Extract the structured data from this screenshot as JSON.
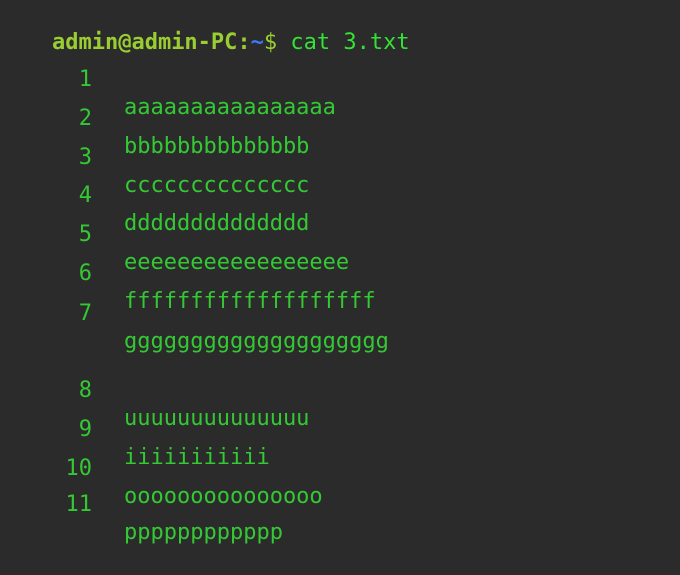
{
  "prompt": {
    "user_host": "admin@admin-PC",
    "colon": ":",
    "path": "~",
    "dollar": "$",
    "command": " cat 3.txt"
  },
  "lines": [
    {
      "num": "1",
      "text": "aaaaaaaaaaaaaaaa"
    },
    {
      "num": "2",
      "text": "bbbbbbbbbbbbbb"
    },
    {
      "num": "3",
      "text": "cccccccccccccc"
    },
    {
      "num": "4",
      "text": "dddddddddddddd"
    },
    {
      "num": "5",
      "text": "eeeeeeeeeeeeeeeee"
    },
    {
      "num": "6",
      "text": "fffffffffffffffffff"
    },
    {
      "num": "7",
      "text": "gggggggggggggggggggg"
    },
    {
      "num": "",
      "text": ""
    },
    {
      "num": "8",
      "text": "uuuuuuuuuuuuuu"
    },
    {
      "num": "9",
      "text": "iiiiiiiiiii"
    },
    {
      "num": "10",
      "text": "ooooooooooooooo"
    },
    {
      "num": "11",
      "text": "pppppppppppp"
    }
  ],
  "colors": {
    "background": "#2b2b2b",
    "text_green": "#34c934",
    "prompt_green": "#9acd32",
    "path_blue": "#3b78ff"
  }
}
